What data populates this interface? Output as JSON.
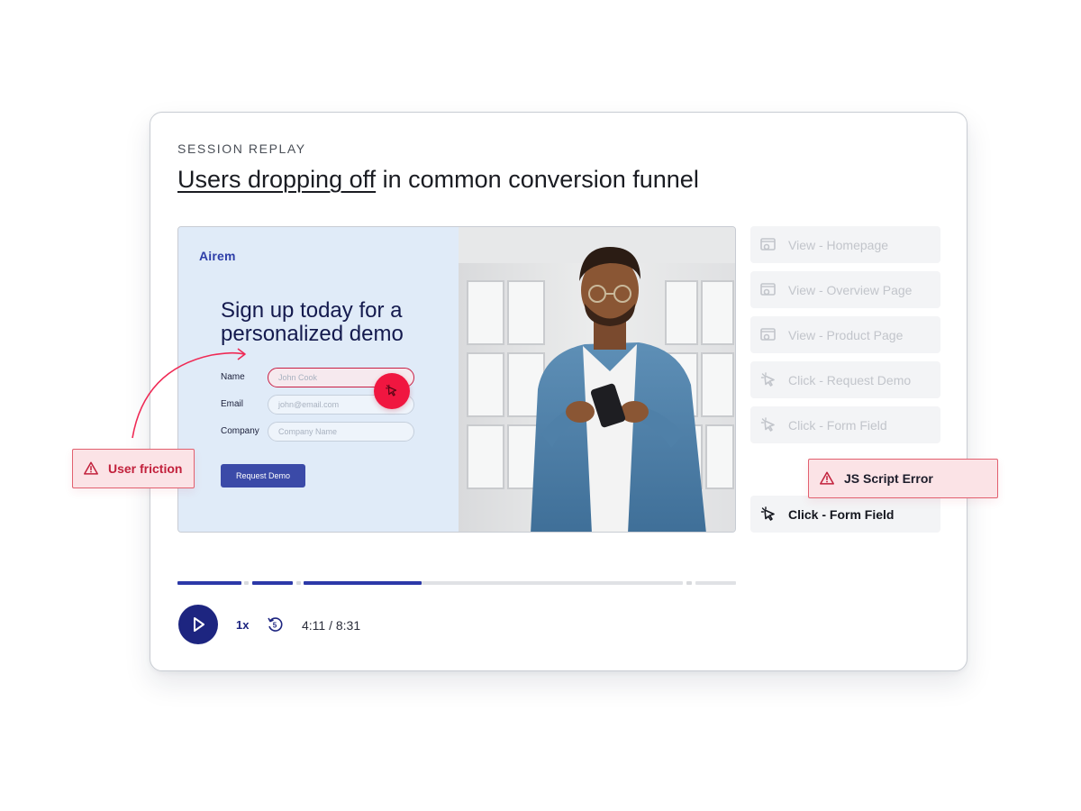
{
  "eyebrow": "SESSION REPLAY",
  "headline": {
    "underlined": "Users dropping off",
    "rest": " in common conversion funnel"
  },
  "landing_page": {
    "brand": "Airem",
    "title": "Sign up today for a personalized demo",
    "fields": [
      {
        "label": "Name",
        "placeholder": "John Cook",
        "state": "error"
      },
      {
        "label": "Email",
        "placeholder": "john@email.com",
        "state": "normal"
      },
      {
        "label": "Company",
        "placeholder": "Company Name",
        "state": "normal"
      }
    ],
    "cta": "Request Demo"
  },
  "player": {
    "speed": "1x",
    "rewind_seconds": "5",
    "time": "4:11 / 8:31",
    "progress_fraction": 0.49
  },
  "events": [
    {
      "icon": "page-view-icon",
      "label": "View - Homepage",
      "active": false
    },
    {
      "icon": "page-view-icon",
      "label": "View - Overview Page",
      "active": false
    },
    {
      "icon": "page-view-icon",
      "label": "View - Product Page",
      "active": false
    },
    {
      "icon": "click-cursor-icon",
      "label": "Click - Request Demo",
      "active": false
    },
    {
      "icon": "click-cursor-icon",
      "label": "Click - Form Field",
      "active": false
    },
    {
      "icon": "click-cursor-icon",
      "label": "Click - Form Field",
      "active": true
    }
  ],
  "callouts": {
    "friction": "User friction",
    "error": "JS Script Error"
  },
  "colors": {
    "primary": "#1d2580",
    "accent_red": "#f01640",
    "callout_text": "#c2213c",
    "landing_bg": "#e0ebf8"
  }
}
